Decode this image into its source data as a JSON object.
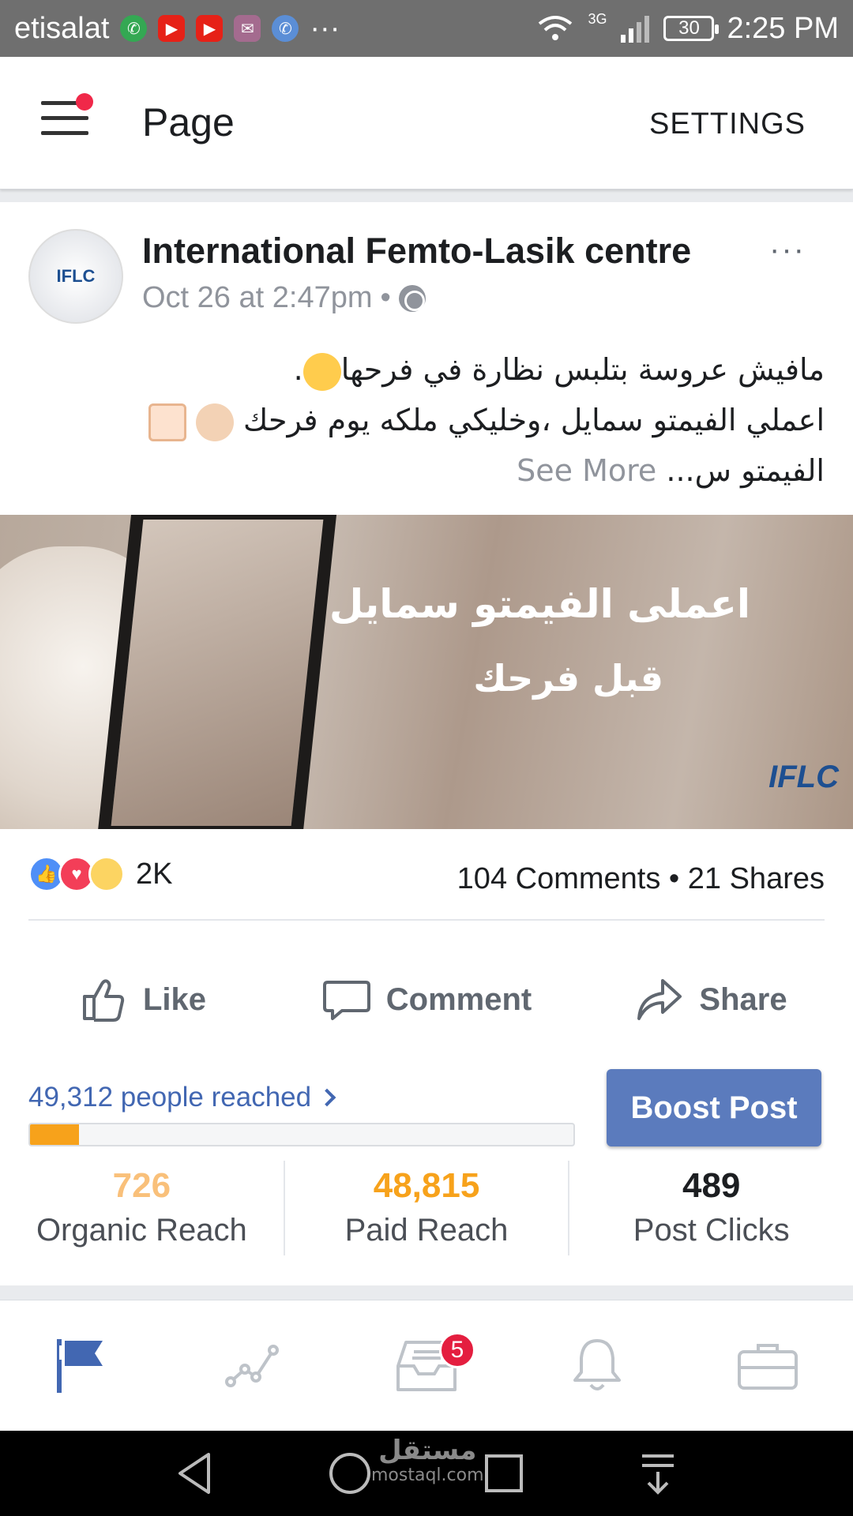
{
  "status_bar": {
    "carrier": "etisalat",
    "network": "3G",
    "battery": "30",
    "time": "2:25 PM",
    "more": "···"
  },
  "app_bar": {
    "title": "Page",
    "settings_label": "SETTINGS"
  },
  "post": {
    "avatar_text": "IFLC",
    "page_name": "International Femto-Lasik centre",
    "timestamp": "Oct 26 at 2:47pm",
    "separator": "•",
    "more": "···",
    "text_line1": "مافيش عروسة بتلبس نظارة في فرحها",
    "text_line1_end": ".",
    "text_line2": "اعملي الفيمتو سمايل ،وخليكي ملكه يوم فرحك",
    "text_line3": "الفيمتو س...",
    "see_more": "See More",
    "image": {
      "headline": "اعملى الفيمتو سمايل",
      "subline": "قبل فرحك",
      "logo": "IFLC"
    },
    "reaction_count": "2K",
    "engagement": "104 Comments • 21 Shares",
    "actions": {
      "like": "Like",
      "comment": "Comment",
      "share": "Share"
    },
    "reach_text": "49,312 people reached",
    "reach_progress_fraction": 0.015,
    "boost_label": "Boost Post",
    "stats": [
      {
        "value": "726",
        "label": "Organic Reach",
        "color": "#f9c07a"
      },
      {
        "value": "48,815",
        "label": "Paid Reach",
        "color": "#f7a21b"
      },
      {
        "value": "489",
        "label": "Post Clicks",
        "color": "#1c1e21"
      }
    ]
  },
  "bottom_nav": {
    "notification_badge": "5",
    "active_color": "#4267b2",
    "inactive_color": "#bec3c9"
  },
  "watermark": {
    "arabic": "مستقل",
    "latin": "mostaql.com"
  }
}
